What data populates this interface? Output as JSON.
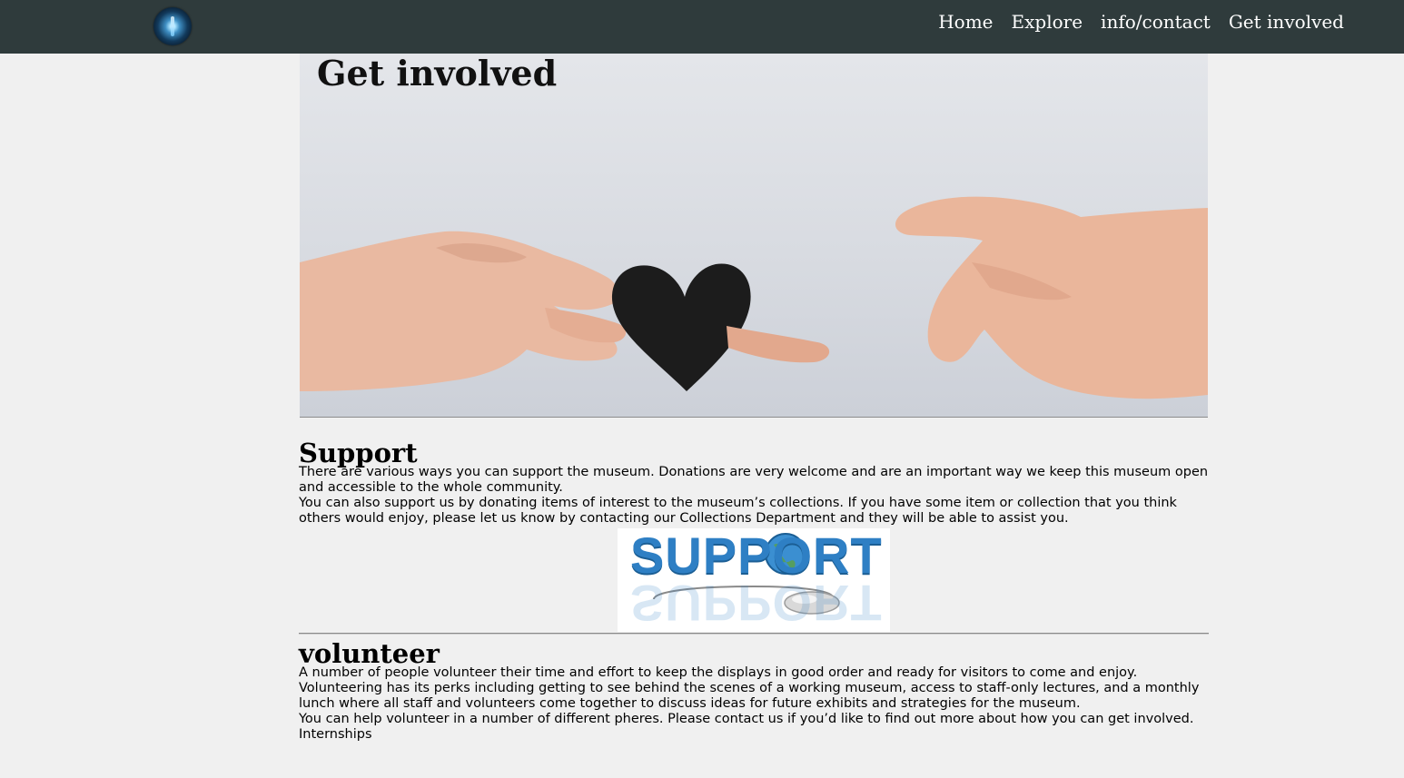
{
  "nav": {
    "logo_icon": "orb-logo-icon",
    "links": [
      "Home",
      "Explore",
      "info/contact",
      "Get involved"
    ]
  },
  "hero": {
    "title": "Get involved",
    "image": "hands-holding-black-heart"
  },
  "support": {
    "heading": "Support",
    "paragraphs": [
      "There are various ways you can support the museum. Donations are very welcome and are an important way we keep this museum open and accessible to the whole community.",
      "You can also support us by donating items of interest to the museum’s collections. If you have some item or collection that you think others would enjoy, please let us know by contacting our Collections Department and they will be able to assist you."
    ],
    "image_text": "SUPPORT"
  },
  "volunteer": {
    "heading": "volunteer",
    "paragraphs": [
      "A number of people volunteer their time and effort to keep the displays in good order and ready for visitors to come and enjoy.",
      "Volunteering has its perks including getting to see behind the scenes of a working museum, access to staff-only lectures, and a monthly lunch where all staff and volunteers come together to discuss ideas for future exhibits and strategies for the museum.",
      "You can help volunteer in a number of different pheres. Please contact us if you’d like to find out more about how you can get involved.",
      "Internships"
    ]
  },
  "colors": {
    "navbar": "#2f3b3c",
    "page_bg": "#f0f0f0",
    "support_blue": "#2e7fc4"
  }
}
